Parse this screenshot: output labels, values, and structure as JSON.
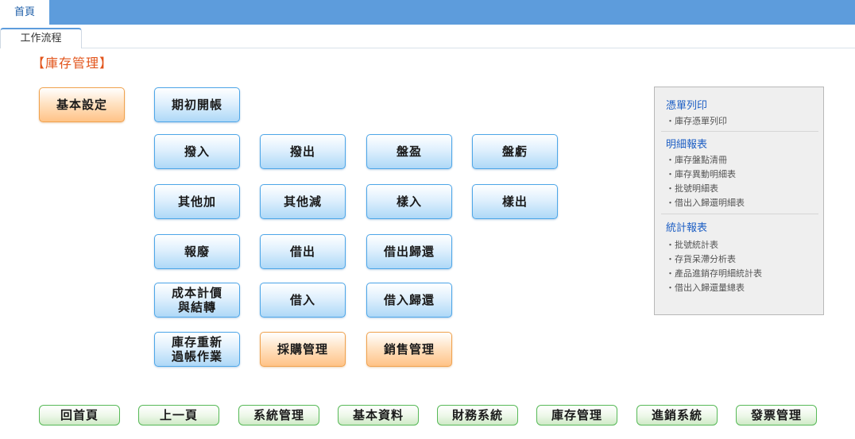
{
  "header": {
    "home_tab": "首頁"
  },
  "subtabs": {
    "workflow": "工作流程"
  },
  "page": {
    "title": "【庫存管理】"
  },
  "buttons": {
    "basic_setup": "基本設定",
    "opening_entry": "期初開帳",
    "transfer_in": "撥入",
    "transfer_out": "撥出",
    "inventory_gain": "盤盈",
    "inventory_loss": "盤虧",
    "other_add": "其他加",
    "other_sub": "其他減",
    "sample_in": "樣入",
    "sample_out": "樣出",
    "scrap": "報廢",
    "lend_out": "借出",
    "lend_out_return": "借出歸還",
    "cost_valuation": "成本計價\n與結轉",
    "borrow_in": "借入",
    "borrow_in_return": "借入歸還",
    "inventory_repost": "庫存重新\n過帳作業",
    "purchasing": "採購管理",
    "sales": "銷售管理"
  },
  "reports": {
    "voucher_print": {
      "heading": "憑單列印",
      "items": [
        "・庫存憑單列印"
      ]
    },
    "detail": {
      "heading": "明細報表",
      "items": [
        "・庫存盤點清冊",
        "・庫存異動明細表",
        "・批號明細表",
        "・借出入歸還明細表"
      ]
    },
    "statistics": {
      "heading": "統計報表",
      "items": [
        "・批號統計表",
        "・存貨呆滯分析表",
        "・產品進銷存明細統計表",
        "・借出入歸還量總表"
      ]
    }
  },
  "footer_nav": [
    "回首頁",
    "上一頁",
    "系統管理",
    "基本資料",
    "財務系統",
    "庫存管理",
    "進銷系統",
    "發票管理"
  ]
}
